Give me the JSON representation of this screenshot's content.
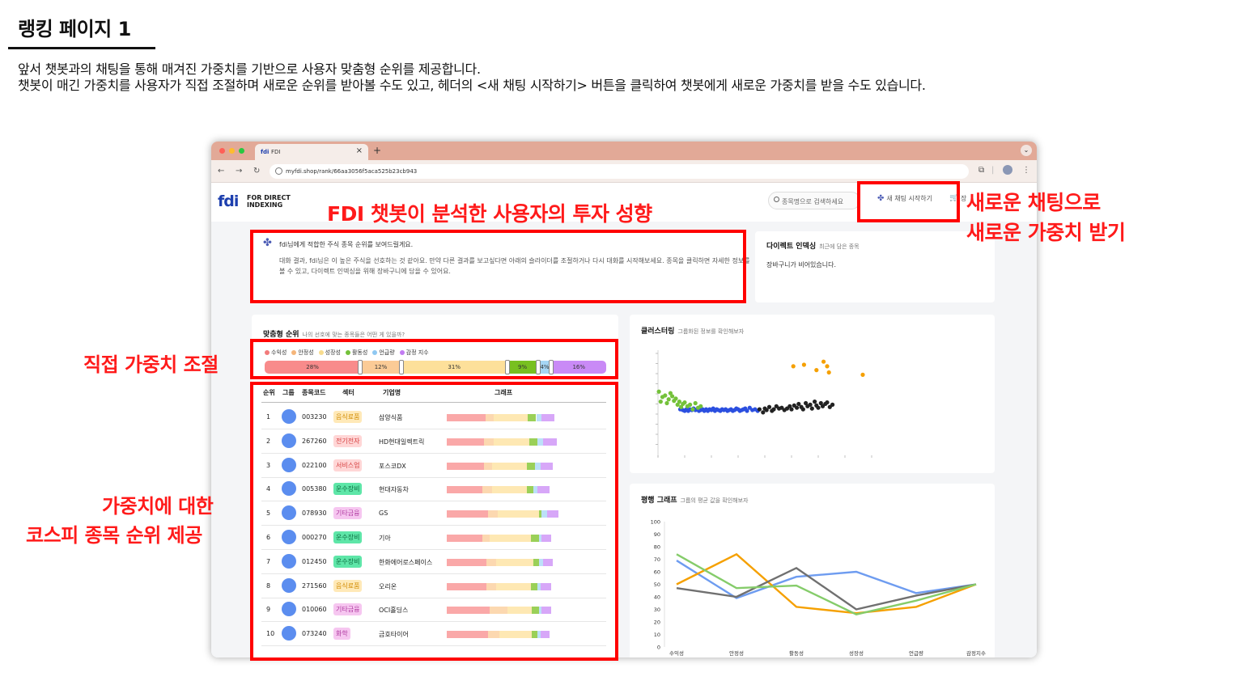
{
  "slide": {
    "title": "랭킹 페이지 1",
    "desc_line1": "앞서 챗봇과의 채팅을 통해 매겨진 가중치를 기반으로 사용자 맞춤형 순위를 제공합니다.",
    "desc_line2": "챗봇이 매긴 가중치를 사용자가 직접 조절하며 새로운 순위를 받아볼 수도 있고, 헤더의 <새 채팅 시작하기> 버튼을 클릭하여 챗봇에게 새로운 가중치를 받을 수도 있습니다."
  },
  "browser": {
    "tab_title": "FDI",
    "favicon": "fdi",
    "url": "myfdi.shop/rank/66aa3056f5aca525b23cb943",
    "colors": {
      "tabbar": "#e2a997",
      "toolbar": "#f5ede9"
    }
  },
  "header": {
    "logo_mark": "fdi",
    "logo_line1": "FOR DIRECT",
    "logo_line2": "INDEXING",
    "search_placeholder": "종목명으로 검색하세요",
    "new_chat_label": "새 채팅 시작하기",
    "cart_label": "장"
  },
  "bot_message": {
    "title": "fdi님에게 적합한 주식 종목 순위를 보여드릴게요.",
    "body": "대화 결과, fdi님은 이 높은 주식을 선호하는 것 같아요. 만약 다른 결과를 보고싶다면 아래의 슬라이더를 조절하거나 다시 대화를 시작해보세요. 종목을 클릭하면 자세한 정보를 볼 수 있고, 다이렉트 인덱싱을 위해 장바구니에 담을 수 있어요."
  },
  "direct_indexing": {
    "title": "다이렉트 인덱싱",
    "subtitle": "최근에 담은 종목",
    "empty_text": "장바구니가 비어있습니다."
  },
  "ranking": {
    "title": "맞춤형 순위",
    "subtitle": "나의 선호에 맞는 종목들은 어떤 게 있을까?",
    "legend": [
      {
        "label": "수익성",
        "color": "#f27b7b"
      },
      {
        "label": "안정성",
        "color": "#f5b57a"
      },
      {
        "label": "성장성",
        "color": "#f8dc8e"
      },
      {
        "label": "활동성",
        "color": "#74c13a"
      },
      {
        "label": "언급량",
        "color": "#8fc8f2"
      },
      {
        "label": "감정 지수",
        "color": "#c27cf2"
      }
    ],
    "weights": [
      {
        "label": "28%",
        "value": 28,
        "color": "#f88b8b"
      },
      {
        "label": "12%",
        "value": 12,
        "color": "#fbcb96"
      },
      {
        "label": "31%",
        "value": 31,
        "color": "#fde09a"
      },
      {
        "label": "9%",
        "value": 9,
        "color": "#78c020"
      },
      {
        "label": "4%",
        "value": 4,
        "color": "#a6d6f5"
      },
      {
        "label": "16%",
        "value": 16,
        "color": "#c98af6"
      }
    ],
    "columns": [
      "순위",
      "그룹",
      "종목코드",
      "섹터",
      "기업명",
      "그래프"
    ],
    "rows": [
      {
        "rank": "1",
        "code": "003230",
        "sector": "음식료품",
        "sector_bg": "#ffe9b8",
        "sector_fg": "#d18a00",
        "name": "삼양식품",
        "mix": [
          0.28,
          0.06,
          0.25,
          0.06,
          0.04,
          0.09
        ]
      },
      {
        "rank": "2",
        "code": "267260",
        "sector": "전기전자",
        "sector_bg": "#ffd6d6",
        "sector_fg": "#d64040",
        "name": "HD현대일렉트릭",
        "mix": [
          0.27,
          0.07,
          0.26,
          0.06,
          0.04,
          0.1
        ]
      },
      {
        "rank": "3",
        "code": "022100",
        "sector": "서비스업",
        "sector_bg": "#ffd6d6",
        "sector_fg": "#d64040",
        "name": "포스코DX",
        "mix": [
          0.27,
          0.06,
          0.25,
          0.06,
          0.04,
          0.09
        ]
      },
      {
        "rank": "4",
        "code": "005380",
        "sector": "운수장비",
        "sector_bg": "#5ee6a8",
        "sector_fg": "#0b6e40",
        "name": "현대자동차",
        "mix": [
          0.26,
          0.07,
          0.25,
          0.05,
          0.03,
          0.09
        ]
      },
      {
        "rank": "5",
        "code": "078930",
        "sector": "기타금융",
        "sector_bg": "#f6c6f0",
        "sector_fg": "#b03aa0",
        "name": "GS",
        "mix": [
          0.3,
          0.07,
          0.3,
          0.02,
          0.04,
          0.08
        ]
      },
      {
        "rank": "6",
        "code": "000270",
        "sector": "운수장비",
        "sector_bg": "#5ee6a8",
        "sector_fg": "#0b6e40",
        "name": "기아",
        "mix": [
          0.26,
          0.05,
          0.3,
          0.06,
          0.02,
          0.07
        ]
      },
      {
        "rank": "7",
        "code": "012450",
        "sector": "운수장비",
        "sector_bg": "#5ee6a8",
        "sector_fg": "#0b6e40",
        "name": "한화에어로스페이스",
        "mix": [
          0.29,
          0.07,
          0.27,
          0.04,
          0.03,
          0.07
        ]
      },
      {
        "rank": "8",
        "code": "271560",
        "sector": "음식료품",
        "sector_bg": "#ffe9b8",
        "sector_fg": "#d18a00",
        "name": "오리온",
        "mix": [
          0.29,
          0.07,
          0.25,
          0.05,
          0.02,
          0.08
        ]
      },
      {
        "rank": "9",
        "code": "010060",
        "sector": "기타금융",
        "sector_bg": "#f6c6f0",
        "sector_fg": "#b03aa0",
        "name": "OCI홀딩스",
        "mix": [
          0.31,
          0.13,
          0.18,
          0.05,
          0.02,
          0.07
        ]
      },
      {
        "rank": "10",
        "code": "073240",
        "sector": "화학",
        "sector_bg": "#f6c6f0",
        "sector_fg": "#b03aa0",
        "name": "금호타이어",
        "mix": [
          0.3,
          0.08,
          0.24,
          0.04,
          0.02,
          0.07
        ]
      }
    ]
  },
  "clustering": {
    "title": "클러스터링",
    "subtitle": "그룹화된 정보를 확인해보자"
  },
  "chart_data": [
    {
      "type": "scatter",
      "title": "클러스터링",
      "series": [
        {
          "color": "#2b4fe0",
          "points": [
            [
              25,
              62
            ],
            [
              28,
              61
            ],
            [
              30,
              60
            ],
            [
              32,
              62
            ],
            [
              34,
              60
            ],
            [
              36,
              62
            ],
            [
              38,
              61
            ],
            [
              40,
              63
            ],
            [
              42,
              61
            ],
            [
              44,
              62
            ],
            [
              46,
              60
            ],
            [
              48,
              61
            ],
            [
              50,
              62
            ],
            [
              52,
              60
            ],
            [
              54,
              62
            ],
            [
              56,
              60
            ],
            [
              58,
              62
            ],
            [
              60,
              61
            ],
            [
              62,
              63
            ],
            [
              64,
              60
            ],
            [
              66,
              62
            ],
            [
              68,
              61
            ],
            [
              70,
              60
            ],
            [
              72,
              62
            ],
            [
              74,
              61
            ],
            [
              76,
              62
            ],
            [
              78,
              60
            ],
            [
              80,
              61
            ],
            [
              82,
              62
            ],
            [
              84,
              60
            ],
            [
              86,
              61
            ],
            [
              88,
              63
            ],
            [
              90,
              62
            ],
            [
              92,
              60
            ],
            [
              94,
              61
            ],
            [
              96,
              62
            ],
            [
              98,
              63
            ],
            [
              100,
              60
            ],
            [
              103,
              64
            ],
            [
              106,
              61
            ],
            [
              109,
              62
            ],
            [
              112,
              60
            ]
          ]
        },
        {
          "color": "#222222",
          "points": [
            [
              114,
              62
            ],
            [
              118,
              58
            ],
            [
              120,
              63
            ],
            [
              122,
              61
            ],
            [
              125,
              65
            ],
            [
              128,
              60
            ],
            [
              130,
              62
            ],
            [
              133,
              66
            ],
            [
              136,
              63
            ],
            [
              139,
              64
            ],
            [
              142,
              61
            ],
            [
              145,
              63
            ],
            [
              148,
              66
            ],
            [
              150,
              62
            ],
            [
              153,
              67
            ],
            [
              156,
              64
            ],
            [
              158,
              69
            ],
            [
              161,
              65
            ],
            [
              163,
              62
            ],
            [
              166,
              70
            ],
            [
              168,
              66
            ],
            [
              171,
              68
            ],
            [
              173,
              63
            ],
            [
              176,
              72
            ],
            [
              178,
              67
            ],
            [
              180,
              64
            ],
            [
              183,
              70
            ],
            [
              185,
              66
            ],
            [
              188,
              69
            ],
            [
              190,
              71
            ],
            [
              193,
              65
            ],
            [
              196,
              68
            ]
          ]
        },
        {
          "color": "#74c13a",
          "points": [
            [
              1,
              85
            ],
            [
              3,
              72
            ],
            [
              5,
              78
            ],
            [
              8,
              80
            ],
            [
              10,
              70
            ],
            [
              12,
              75
            ],
            [
              14,
              83
            ],
            [
              16,
              79
            ],
            [
              18,
              73
            ],
            [
              20,
              76
            ],
            [
              22,
              68
            ],
            [
              24,
              72
            ],
            [
              26,
              65
            ],
            [
              28,
              69
            ],
            [
              30,
              71
            ],
            [
              33,
              66
            ],
            [
              36,
              68
            ],
            [
              39,
              62
            ],
            [
              42,
              70
            ],
            [
              45,
              64
            ],
            [
              48,
              66
            ]
          ]
        },
        {
          "color": "#f5a000",
          "points": [
            [
              152,
              118
            ],
            [
              164,
              120
            ],
            [
              178,
              113
            ],
            [
              186,
              124
            ],
            [
              190,
              118
            ],
            [
              192,
              110
            ],
            [
              230,
              107
            ]
          ]
        }
      ]
    },
    {
      "type": "line",
      "title": "평행 그래프",
      "categories": [
        "수익성",
        "안정성",
        "활동성",
        "성장성",
        "언급량",
        "감정지수"
      ],
      "ylim": [
        0,
        100
      ],
      "yticks": [
        0,
        10,
        20,
        30,
        40,
        50,
        60,
        70,
        80,
        90,
        100
      ],
      "series": [
        {
          "color": "#6e9cf0",
          "values": [
            69,
            39,
            56,
            60,
            43,
            50
          ]
        },
        {
          "color": "#f5a000",
          "values": [
            50,
            74,
            32,
            27,
            32,
            50
          ]
        },
        {
          "color": "#707070",
          "values": [
            47,
            40,
            63,
            30,
            41,
            50
          ]
        },
        {
          "color": "#85cc6a",
          "values": [
            74,
            47,
            49,
            26,
            37,
            50
          ]
        }
      ]
    }
  ],
  "parallel": {
    "title": "평행 그래프",
    "subtitle": "그룹의 평균 값을 확인해보자"
  },
  "annotations": {
    "investment_style": "FDI 챗봇이 분석한 사용자의 투자 성향",
    "new_chat_line1": "새로운 채팅으로",
    "new_chat_line2": "새로운 가중치 받기",
    "weight_adjust": "직접 가중치 조절",
    "ranking_line1": "가중치에 대한",
    "ranking_line2": "코스피 종목 순위 제공",
    "color": "#ff0000"
  }
}
